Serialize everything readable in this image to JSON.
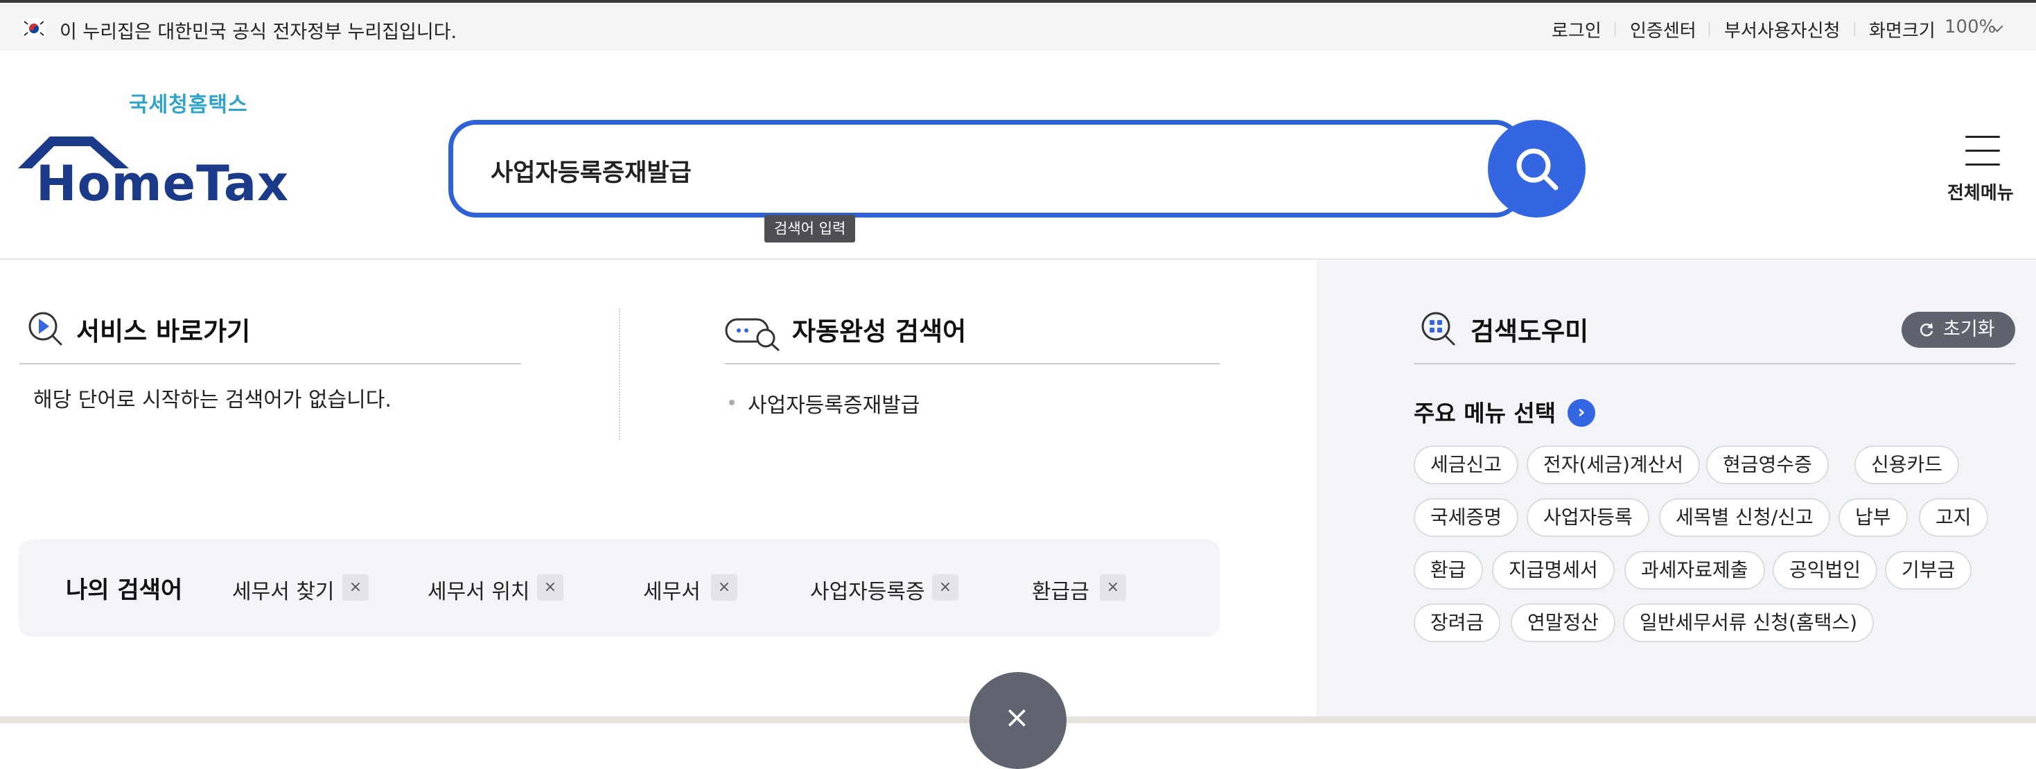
{
  "gov_banner": {
    "text": "이 누리집은 대한민국 공식 전자정부 누리집입니다.",
    "links": [
      "로그인",
      "인증센터",
      "부서사용자신청"
    ],
    "zoom_label": "화면크기",
    "zoom_value": "100%"
  },
  "logo": {
    "sub": "국세청홈택스",
    "main": "HomeTax"
  },
  "search": {
    "value": "사업자등록증재발급",
    "tooltip": "검색어 입력"
  },
  "all_menu": {
    "label": "전체메뉴"
  },
  "service_shortcut": {
    "title": "서비스 바로가기",
    "empty_text": "해당 단어로 시작하는 검색어가 없습니다."
  },
  "autocomplete": {
    "title": "자동완성 검색어",
    "items": [
      "사업자등록증재발급"
    ]
  },
  "recent": {
    "title": "나의 검색어",
    "keywords": [
      "세무서 찾기",
      "세무서 위치",
      "세무서",
      "사업자등록증",
      "환급금"
    ],
    "remove_symbol": "×"
  },
  "close_symbol": "×",
  "helper": {
    "title": "검색도우미",
    "reset_label": "초기화",
    "menu_select": "주요 메뉴 선택",
    "chips": [
      [
        "세금신고",
        "전자(세금)계산서",
        "현금영수증",
        "신용카드"
      ],
      [
        "국세증명",
        "사업자등록",
        "세목별 신청/신고",
        "납부",
        "고지"
      ],
      [
        "환급",
        "지급명세서",
        "과세자료제출",
        "공익법인",
        "기부금"
      ],
      [
        "장려금",
        "연말정산",
        "일반세무서류 신청(홈택스)"
      ]
    ]
  },
  "colors": {
    "accent": "#3366e0",
    "logo_navy": "#1b3a8a",
    "logo_teal": "#2fa3c8"
  }
}
